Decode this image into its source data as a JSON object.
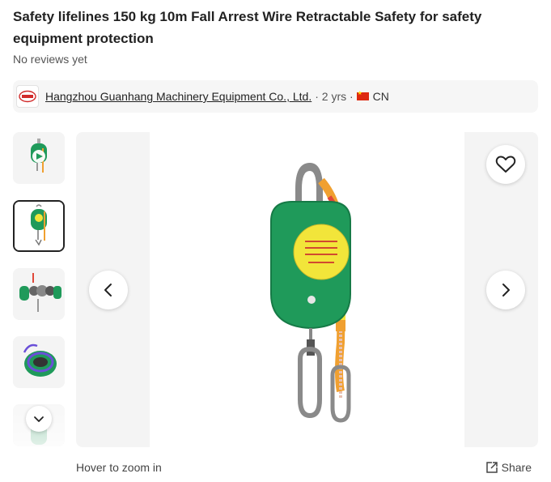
{
  "product": {
    "title": "Safety lifelines 150 kg 10m Fall Arrest Wire Retractable Safety for safety equipment protection",
    "reviews": "No reviews yet"
  },
  "supplier": {
    "logo_text": "GUANHANG",
    "name": "Hangzhou Guanhang Machinery Equipment Co., Ltd.",
    "years": "· 2 yrs ·",
    "country": "CN"
  },
  "gallery": {
    "thumbnails": [
      {
        "name": "thumb-video",
        "has_play": true,
        "active": false
      },
      {
        "name": "thumb-front",
        "has_play": false,
        "active": true
      },
      {
        "name": "thumb-parts",
        "has_play": false,
        "active": false
      },
      {
        "name": "thumb-inside",
        "has_play": false,
        "active": false
      },
      {
        "name": "thumb-more",
        "has_play": false,
        "active": false
      }
    ],
    "zoom_hint": "Hover to zoom in",
    "share_label": "Share"
  },
  "icons": {
    "favorite": "heart-icon",
    "prev": "chevron-left-icon",
    "next": "chevron-right-icon",
    "more": "chevron-down-icon",
    "share": "share-icon",
    "play": "play-icon"
  },
  "colors": {
    "device_green": "#1f9a5a",
    "label_yellow": "#f2e53a",
    "lanyard_orange": "#f0a030",
    "lanyard_red": "#e0483a"
  }
}
